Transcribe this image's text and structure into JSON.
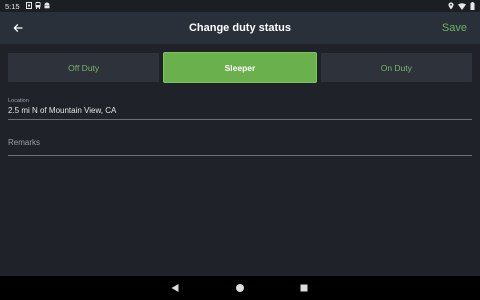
{
  "status_bar": {
    "time": "5:15",
    "notification_icons": [
      "image-icon",
      "bus-icon",
      "android-icon"
    ],
    "system_icons": [
      "location-icon",
      "wifi-icon",
      "battery-icon"
    ]
  },
  "header": {
    "title": "Change duty status",
    "save_label": "Save",
    "back_icon": "arrow-left-icon"
  },
  "duty_tabs": [
    {
      "label": "Off Duty",
      "selected": false
    },
    {
      "label": "Sleeper",
      "selected": true
    },
    {
      "label": "On Duty",
      "selected": false
    }
  ],
  "location": {
    "label": "Location",
    "value": "2.5 mi N of Mountain View, CA"
  },
  "remarks": {
    "placeholder": "Remarks"
  },
  "nav_bar": {
    "icons": [
      "back-triangle-icon",
      "home-circle-icon",
      "recents-square-icon"
    ]
  },
  "colors": {
    "accent": "#6ab04c",
    "tab_text": "#7cb465",
    "background": "#1f2228",
    "app_bar": "#2a303a"
  }
}
